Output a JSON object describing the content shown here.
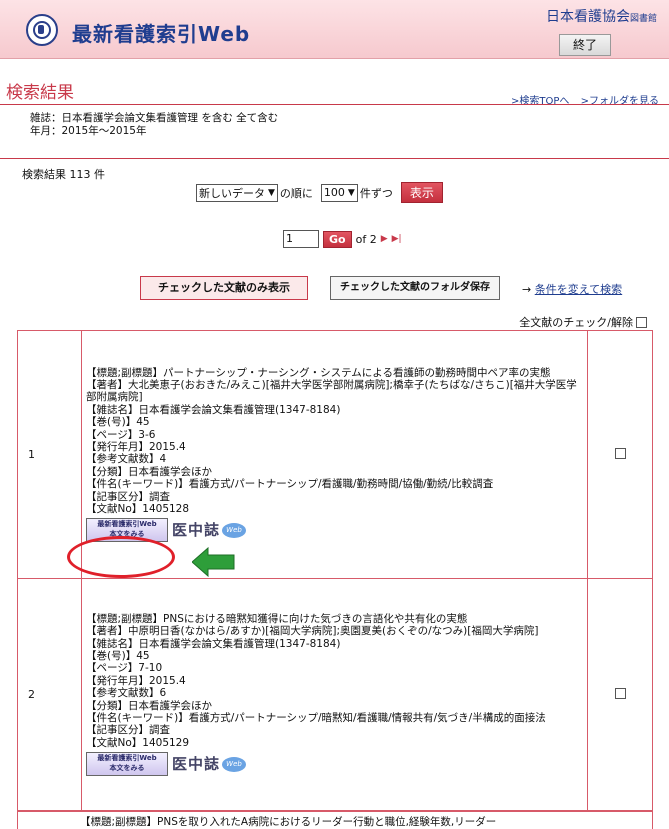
{
  "header": {
    "title": "最新看護索引Web",
    "org": "日本看護協会",
    "org_suffix": "図書館",
    "end_button": "終了"
  },
  "results_title": "検索結果",
  "top_links": [
    ">検索TOPへ",
    ">フォルダを見る"
  ],
  "conditions": [
    "雑誌：日本看護学会論文集看護管理 を含む 全て含む",
    "年月：2015年～2015年"
  ],
  "count_text": "検索結果 113 件",
  "sort": {
    "order_value": "新しいデータ",
    "order_suffix": "の順に",
    "per_page_value": "100",
    "per_page_suffix": "件ずつ",
    "display_button": "表示"
  },
  "pager": {
    "page_value": "1",
    "go_label": "Go",
    "of_text": "of 2"
  },
  "buttons": {
    "show_checked": "チェックした文献のみ表示",
    "save_checked": "チェックした文献のフォルダ保存",
    "change_prefix": "→",
    "change_link": "条件を変えて検索"
  },
  "all_check_label": "全文献のチェック/解除",
  "results": [
    {
      "num": "1",
      "lines": [
        "【標題;副標題】パートナーシップ・ナーシング・システムによる看護師の勤務時間中ペア率の実態",
        "【著者】大北美恵子(おおきた/みえこ)[福井大学医学部附属病院];橋幸子(たちばな/さちこ)[福井大学医学部附属病院]",
        "【雑誌名】日本看護学会論文集看護管理(1347-8184)",
        "【巻(号)】45",
        "【ページ】3-6",
        "【発行年月】2015.4",
        "【参考文献数】4",
        "【分類】日本看護学会ほか",
        "【件名(キーワード)】看護方式/パートナーシップ/看護職/勤務時間/協働/勤続/比較調査",
        "【記事区分】調査",
        "【文献No】1405128"
      ],
      "fulltext_button_l1": "最新看護索引Web",
      "fulltext_button_l2": "本文をみる",
      "ichushi_label": "医中誌",
      "web_label": "Web"
    },
    {
      "num": "2",
      "lines": [
        "【標題;副標題】PNSにおける暗黙知獲得に向けた気づきの言語化や共有化の実態",
        "【著者】中原明日香(なかはら/あすか)[福岡大学病院];奥園夏美(おくぞの/なつみ)[福岡大学病院]",
        "【雑誌名】日本看護学会論文集看護管理(1347-8184)",
        "【巻(号)】45",
        "【ページ】7-10",
        "【発行年月】2015.4",
        "【参考文献数】6",
        "【分類】日本看護学会ほか",
        "【件名(キーワード)】看護方式/パートナーシップ/暗黙知/看護職/情報共有/気づき/半構成的面接法",
        "【記事区分】調査",
        "【文献No】1405129"
      ],
      "fulltext_button_l1": "最新看護索引Web",
      "fulltext_button_l2": "本文をみる",
      "ichushi_label": "医中誌",
      "web_label": "Web"
    }
  ],
  "cut_row_text": "【標題;副標題】PNSを取り入れたA病院におけるリーダー行動と職位,経験年数,リーダー",
  "colors": {
    "accent": "#c8394a",
    "brand_blue": "#1f3d8f",
    "highlight_circle": "#e0202a",
    "arrow_green": "#2e9e3a"
  }
}
